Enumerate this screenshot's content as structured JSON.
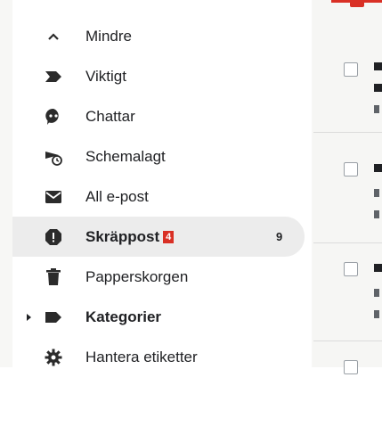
{
  "sidebar": {
    "items": [
      {
        "label": "Mindre",
        "icon": "chevron-up-icon"
      },
      {
        "label": "Viktigt",
        "icon": "important-label-icon"
      },
      {
        "label": "Chattar",
        "icon": "chat-icon"
      },
      {
        "label": "Schemalagt",
        "icon": "scheduled-send-icon"
      },
      {
        "label": "All e-post",
        "icon": "all-mail-icon"
      },
      {
        "label": "Skräppost",
        "icon": "spam-icon",
        "badge": "4",
        "count": "9"
      },
      {
        "label": "Papperskorgen",
        "icon": "trash-icon"
      },
      {
        "label": "Kategorier",
        "icon": "category-label-icon"
      },
      {
        "label": "Hantera etiketter",
        "icon": "settings-gear-icon"
      }
    ]
  },
  "colors": {
    "accent": "#d93025",
    "active_bg": "#ececec",
    "text": "#202124",
    "icon": "#2b2b2b"
  }
}
